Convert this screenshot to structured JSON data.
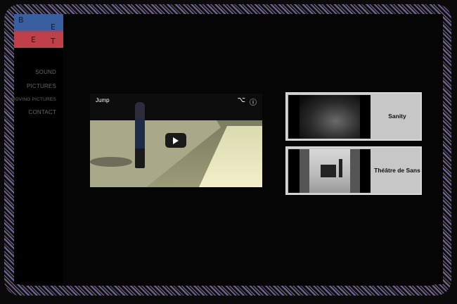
{
  "logo": {
    "letters": [
      "B",
      "E",
      "E",
      "T"
    ]
  },
  "nav": [
    {
      "label": "SOUND"
    },
    {
      "label": "PICTURES"
    },
    {
      "label": "MOVING PICTURES"
    },
    {
      "label": "CONTACT"
    }
  ],
  "video": {
    "title": "Jump",
    "share_icon": "share-icon",
    "info_icon": "info-icon",
    "play_icon": "play-icon"
  },
  "cards": [
    {
      "label": "Sanity"
    },
    {
      "label": "Théâtre de Sans"
    }
  ],
  "colors": {
    "background": "#050505",
    "card": "#c7c7c7",
    "nav_text": "#666666"
  }
}
